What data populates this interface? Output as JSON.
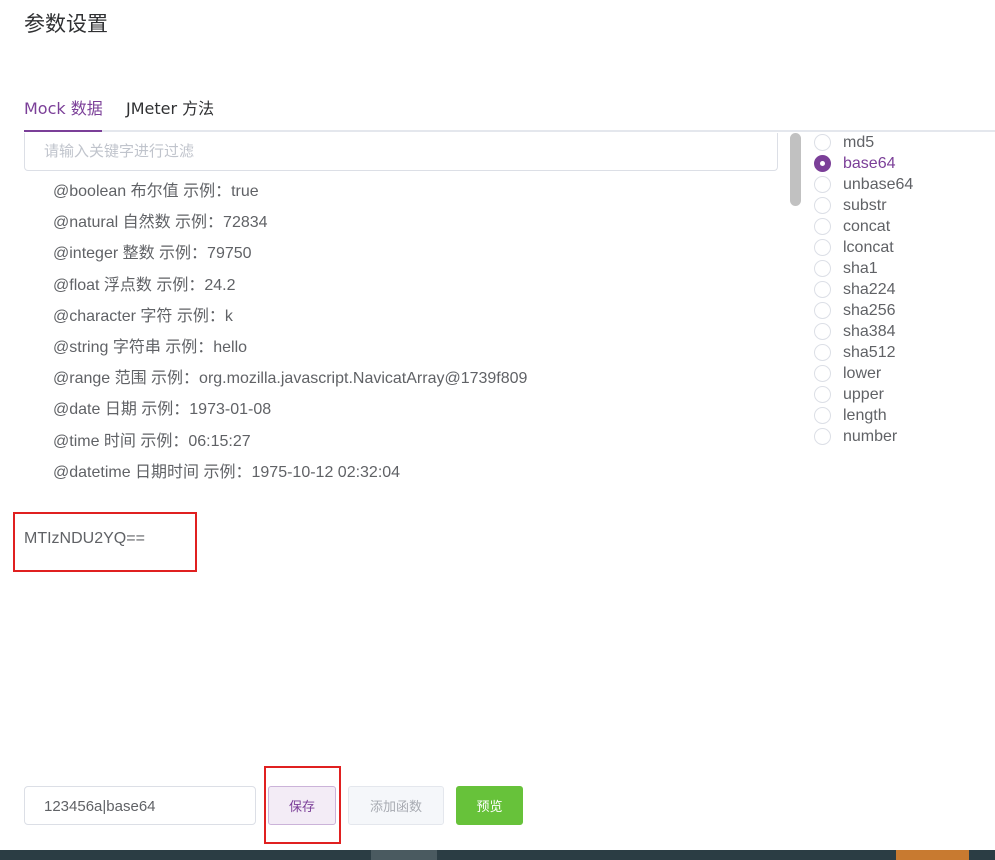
{
  "page": {
    "title": "参数设置"
  },
  "tabs": [
    {
      "label": "Mock 数据",
      "active": true
    },
    {
      "label": "JMeter 方法",
      "active": false
    }
  ],
  "filter": {
    "placeholder": "请输入关键字进行过滤",
    "value": ""
  },
  "mock_list": [
    "@boolean 布尔值 示例：true",
    "@natural 自然数 示例：72834",
    "@integer 整数 示例：79750",
    "@float 浮点数 示例：24.2",
    "@character 字符 示例：k",
    "@string 字符串 示例：hello",
    "@range 范围 示例：org.mozilla.javascript.NavicatArray@1739f809",
    "@date 日期 示例：1973-01-08",
    "@time 时间 示例：06:15:27",
    "@datetime 日期时间 示例：1975-10-12 02:32:04"
  ],
  "functions": {
    "selected": "base64",
    "options": [
      "md5",
      "base64",
      "unbase64",
      "substr",
      "concat",
      "lconcat",
      "sha1",
      "sha224",
      "sha256",
      "sha384",
      "sha512",
      "lower",
      "upper",
      "length",
      "number"
    ]
  },
  "result": {
    "text": "MTIzNDU2YQ=="
  },
  "expression": {
    "value": "123456a|base64"
  },
  "buttons": {
    "save": "保存",
    "add_function": "添加函数",
    "preview": "预览"
  },
  "colors": {
    "accent": "#7b3f98",
    "success": "#67c23a",
    "highlight": "#e02020"
  }
}
